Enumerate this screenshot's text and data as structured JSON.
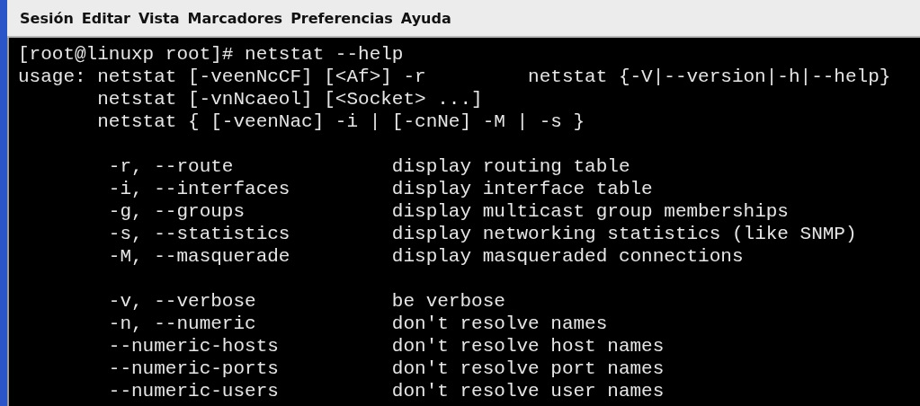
{
  "menu_bar": [
    "Sesión",
    "Editar",
    "Vista",
    "Marcadores",
    "Preferencias",
    "Ayuda"
  ],
  "terminal": {
    "command_line": "[root@linuxp root]# netstat --help",
    "usage": {
      "label": "usage:",
      "lines": [
        [
          "netstat [-veenNcCF] [<Af>] -r",
          "netstat {-V|--version|-h|--help}"
        ],
        [
          "netstat [-vnNcaeol] [<Socket> ...]"
        ],
        [
          "netstat { [-veenNac] -i | [-cnNe] -M | -s }"
        ]
      ]
    },
    "option_groups": [
      [
        {
          "option": "-r, --route",
          "description": "display routing table"
        },
        {
          "option": "-i, --interfaces",
          "description": "display interface table"
        },
        {
          "option": "-g, --groups",
          "description": "display multicast group memberships"
        },
        {
          "option": "-s, --statistics",
          "description": "display networking statistics (like SNMP)"
        },
        {
          "option": "-M, --masquerade",
          "description": "display masqueraded connections"
        }
      ],
      [
        {
          "option": "-v, --verbose",
          "description": "be verbose"
        },
        {
          "option": "-n, --numeric",
          "description": "don't resolve names"
        },
        {
          "option": "--numeric-hosts",
          "description": "don't resolve host names"
        },
        {
          "option": "--numeric-ports",
          "description": "don't resolve port names"
        },
        {
          "option": "--numeric-users",
          "description": "don't resolve user names"
        }
      ]
    ]
  }
}
